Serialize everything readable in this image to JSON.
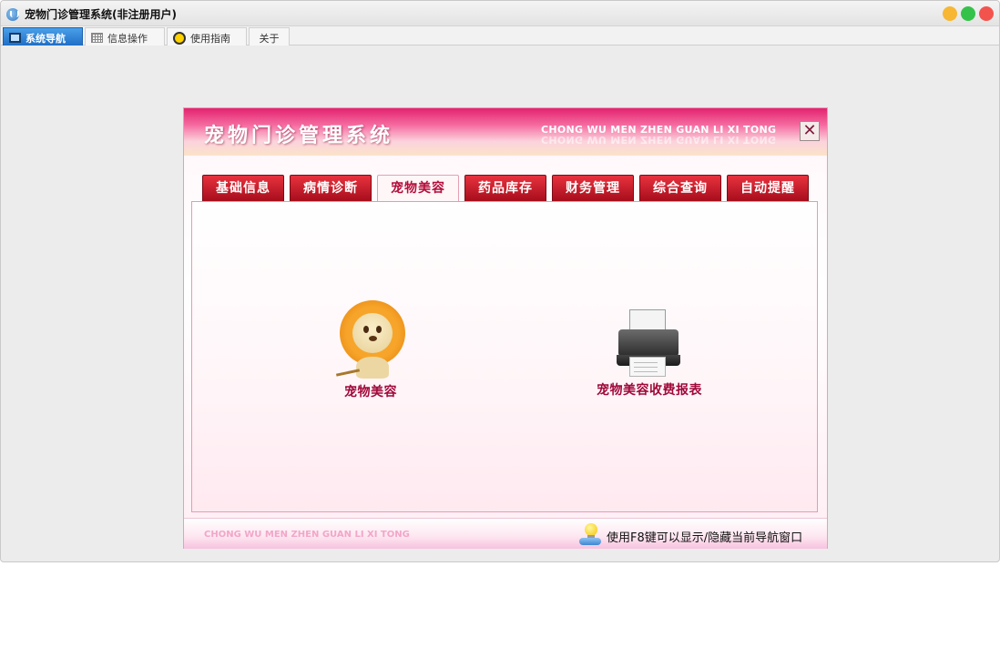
{
  "window": {
    "title": "宠物门诊管理系统(非注册用户)"
  },
  "app_tabs": [
    {
      "label": "系统导航",
      "icon": "monitor-icon",
      "active": true
    },
    {
      "label": "信息操作",
      "icon": "grid-icon",
      "active": false
    },
    {
      "label": "使用指南",
      "icon": "clock-icon",
      "active": false
    },
    {
      "label": "关于",
      "icon": "",
      "active": false
    }
  ],
  "dialog": {
    "title": "宠物门诊管理系统",
    "pinyin": "CHONG WU MEN ZHEN GUAN LI XI TONG",
    "close_glyph": "✕"
  },
  "module_tabs": [
    {
      "label": "基础信息",
      "active": false
    },
    {
      "label": "病情诊断",
      "active": false
    },
    {
      "label": "宠物美容",
      "active": true
    },
    {
      "label": "药品库存",
      "active": false
    },
    {
      "label": "财务管理",
      "active": false
    },
    {
      "label": "综合查询",
      "active": false
    },
    {
      "label": "自动提醒",
      "active": false
    }
  ],
  "features": [
    {
      "label": "宠物美容",
      "icon": "lion-icon"
    },
    {
      "label": "宠物美容收费报表",
      "icon": "printer-icon"
    }
  ],
  "footer": {
    "pinyin": "CHONG WU MEN ZHEN  GUAN LI XI TONG",
    "tip": "使用F8键可以显示/隐藏当前导航窗口"
  },
  "colors": {
    "accent_red": "#c8102e",
    "label_crimson": "#a0083a",
    "header_pink": "#e2236e"
  }
}
